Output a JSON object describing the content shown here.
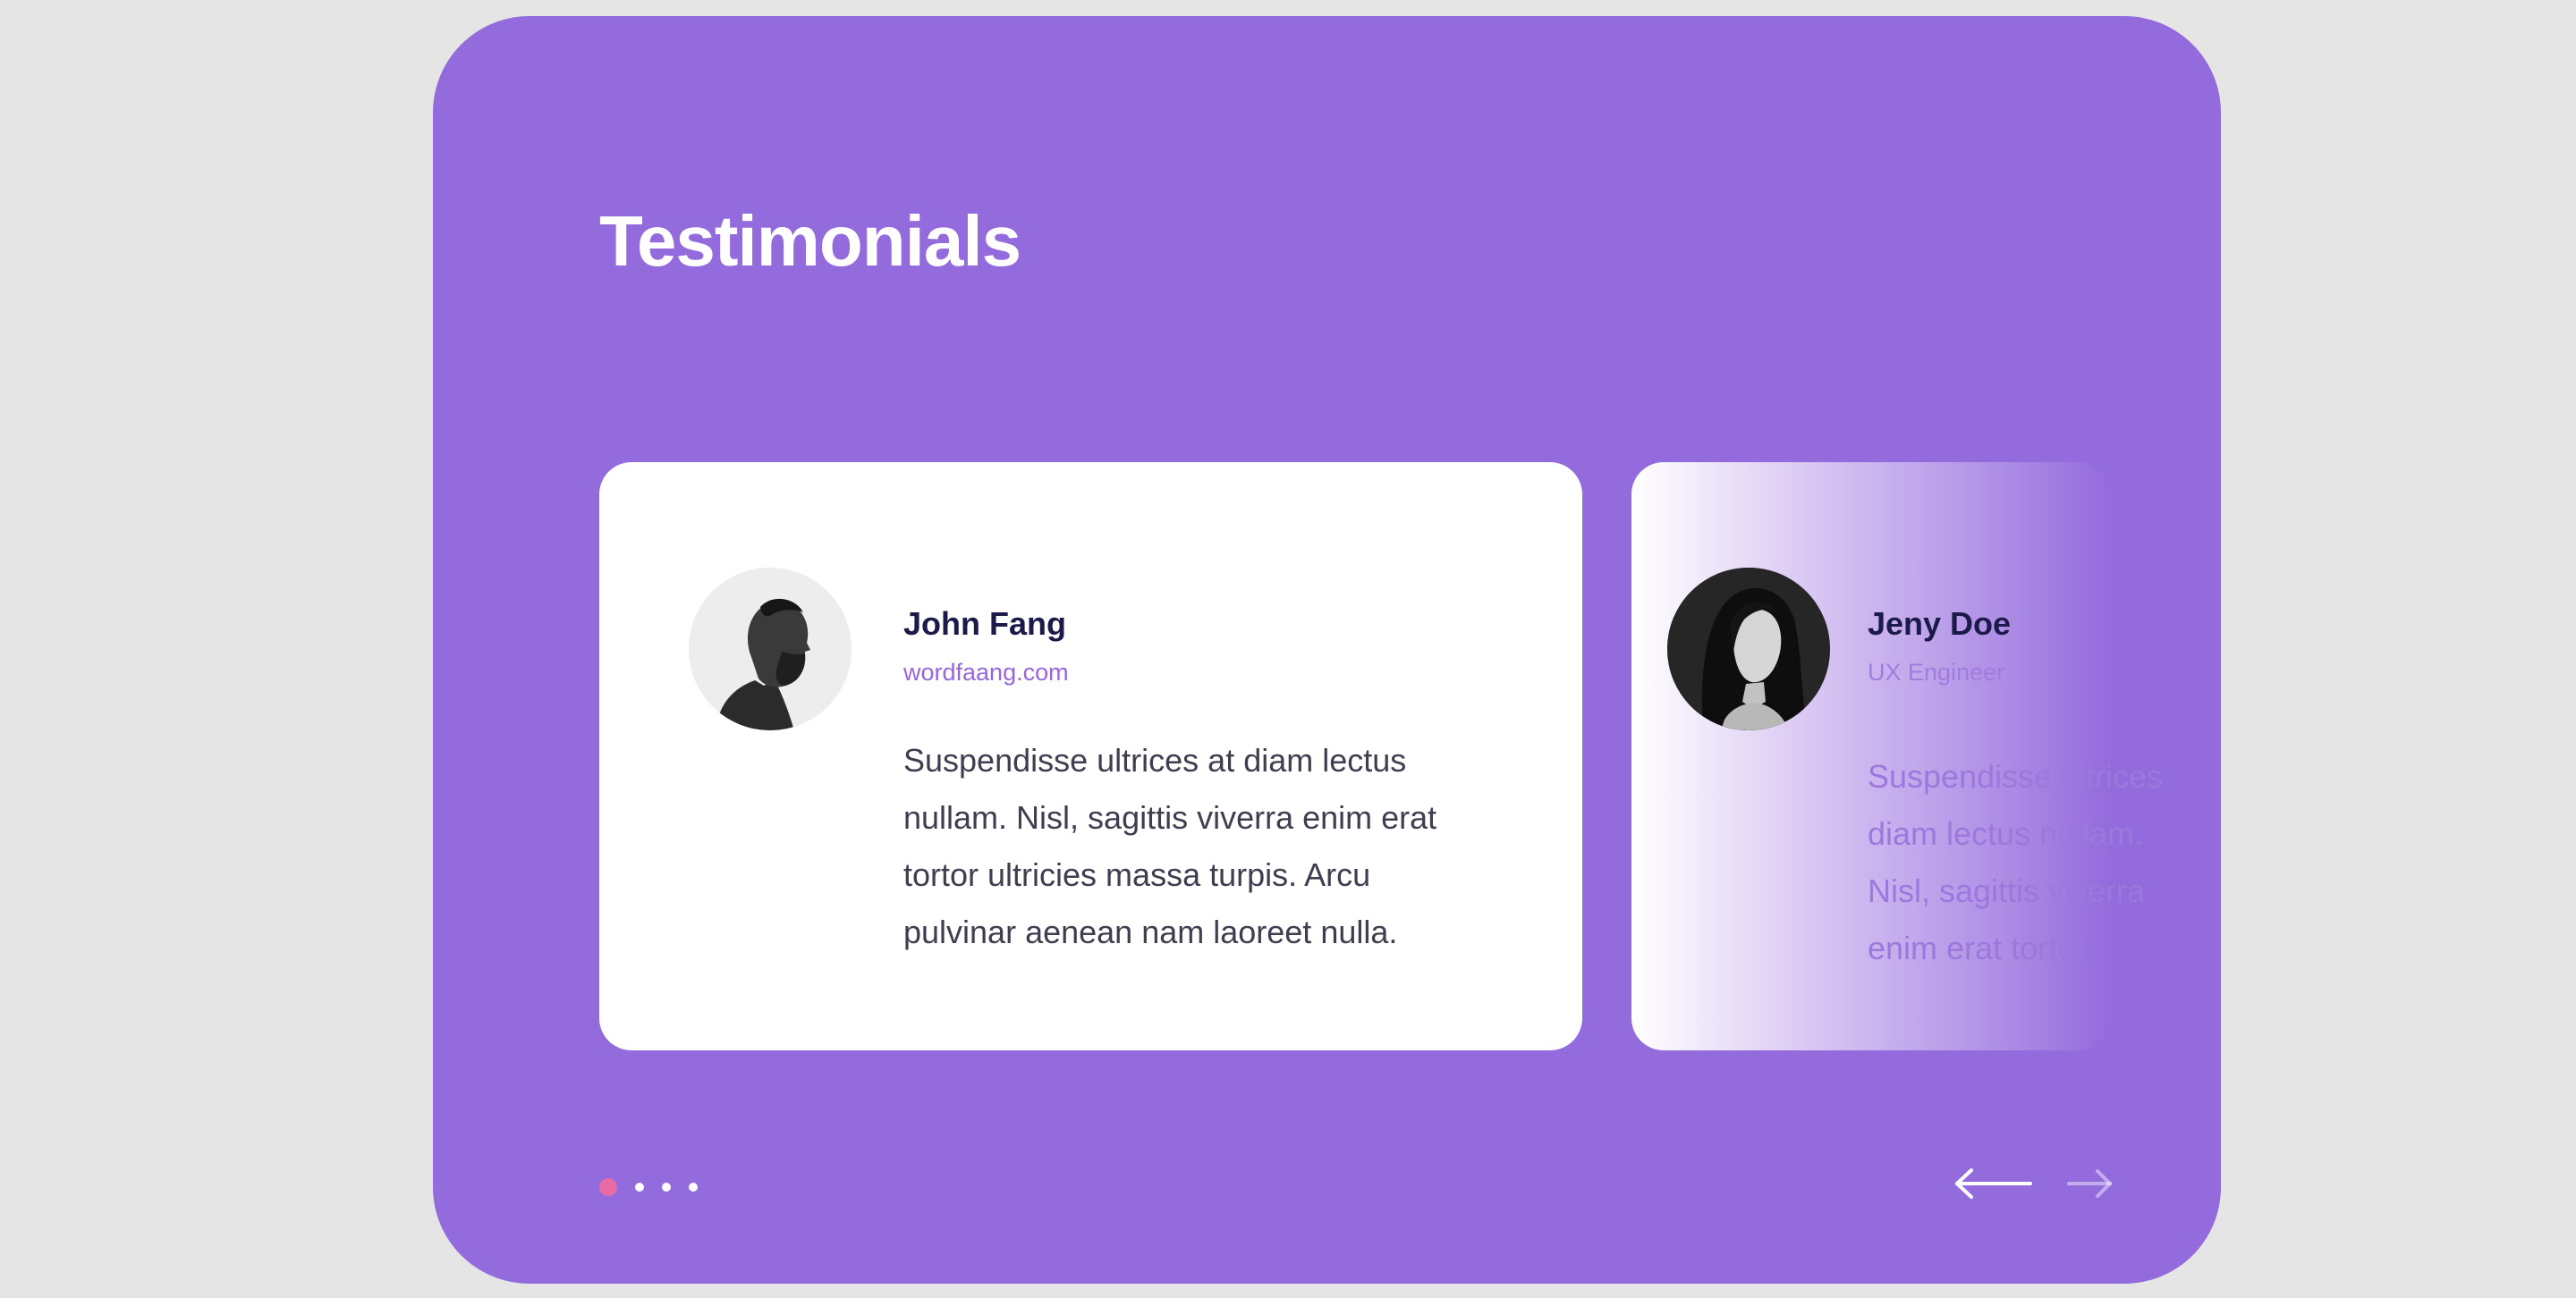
{
  "section": {
    "title": "Testimonials"
  },
  "testimonials": [
    {
      "name": "John Fang",
      "role": "wordfaang.com",
      "quote": "Suspendisse ultrices at diam lectus nullam. Nisl, sagittis viverra enim erat tortor ultricies massa turpis. Arcu pulvinar aenean nam laoreet nulla.",
      "avatar_icon": "man-profile-avatar"
    },
    {
      "name": "Jeny Doe",
      "role": "UX Engineer",
      "quote_lines": [
        "Suspendisse ultrices at",
        "diam lectus nullam.",
        "Nisl, sagittis viverra",
        "enim erat tortor"
      ],
      "avatar_icon": "woman-portrait-avatar"
    }
  ],
  "pagination": {
    "total": 4,
    "current": 1
  },
  "colors": {
    "background": "#e5e5e5",
    "panel": "#946bdc",
    "active_dot": "#e76ca5",
    "name_text": "#1b1a4a",
    "role_text": "#9866dc"
  },
  "icons": {
    "prev": "arrow-left-icon",
    "next": "arrow-right-icon"
  }
}
